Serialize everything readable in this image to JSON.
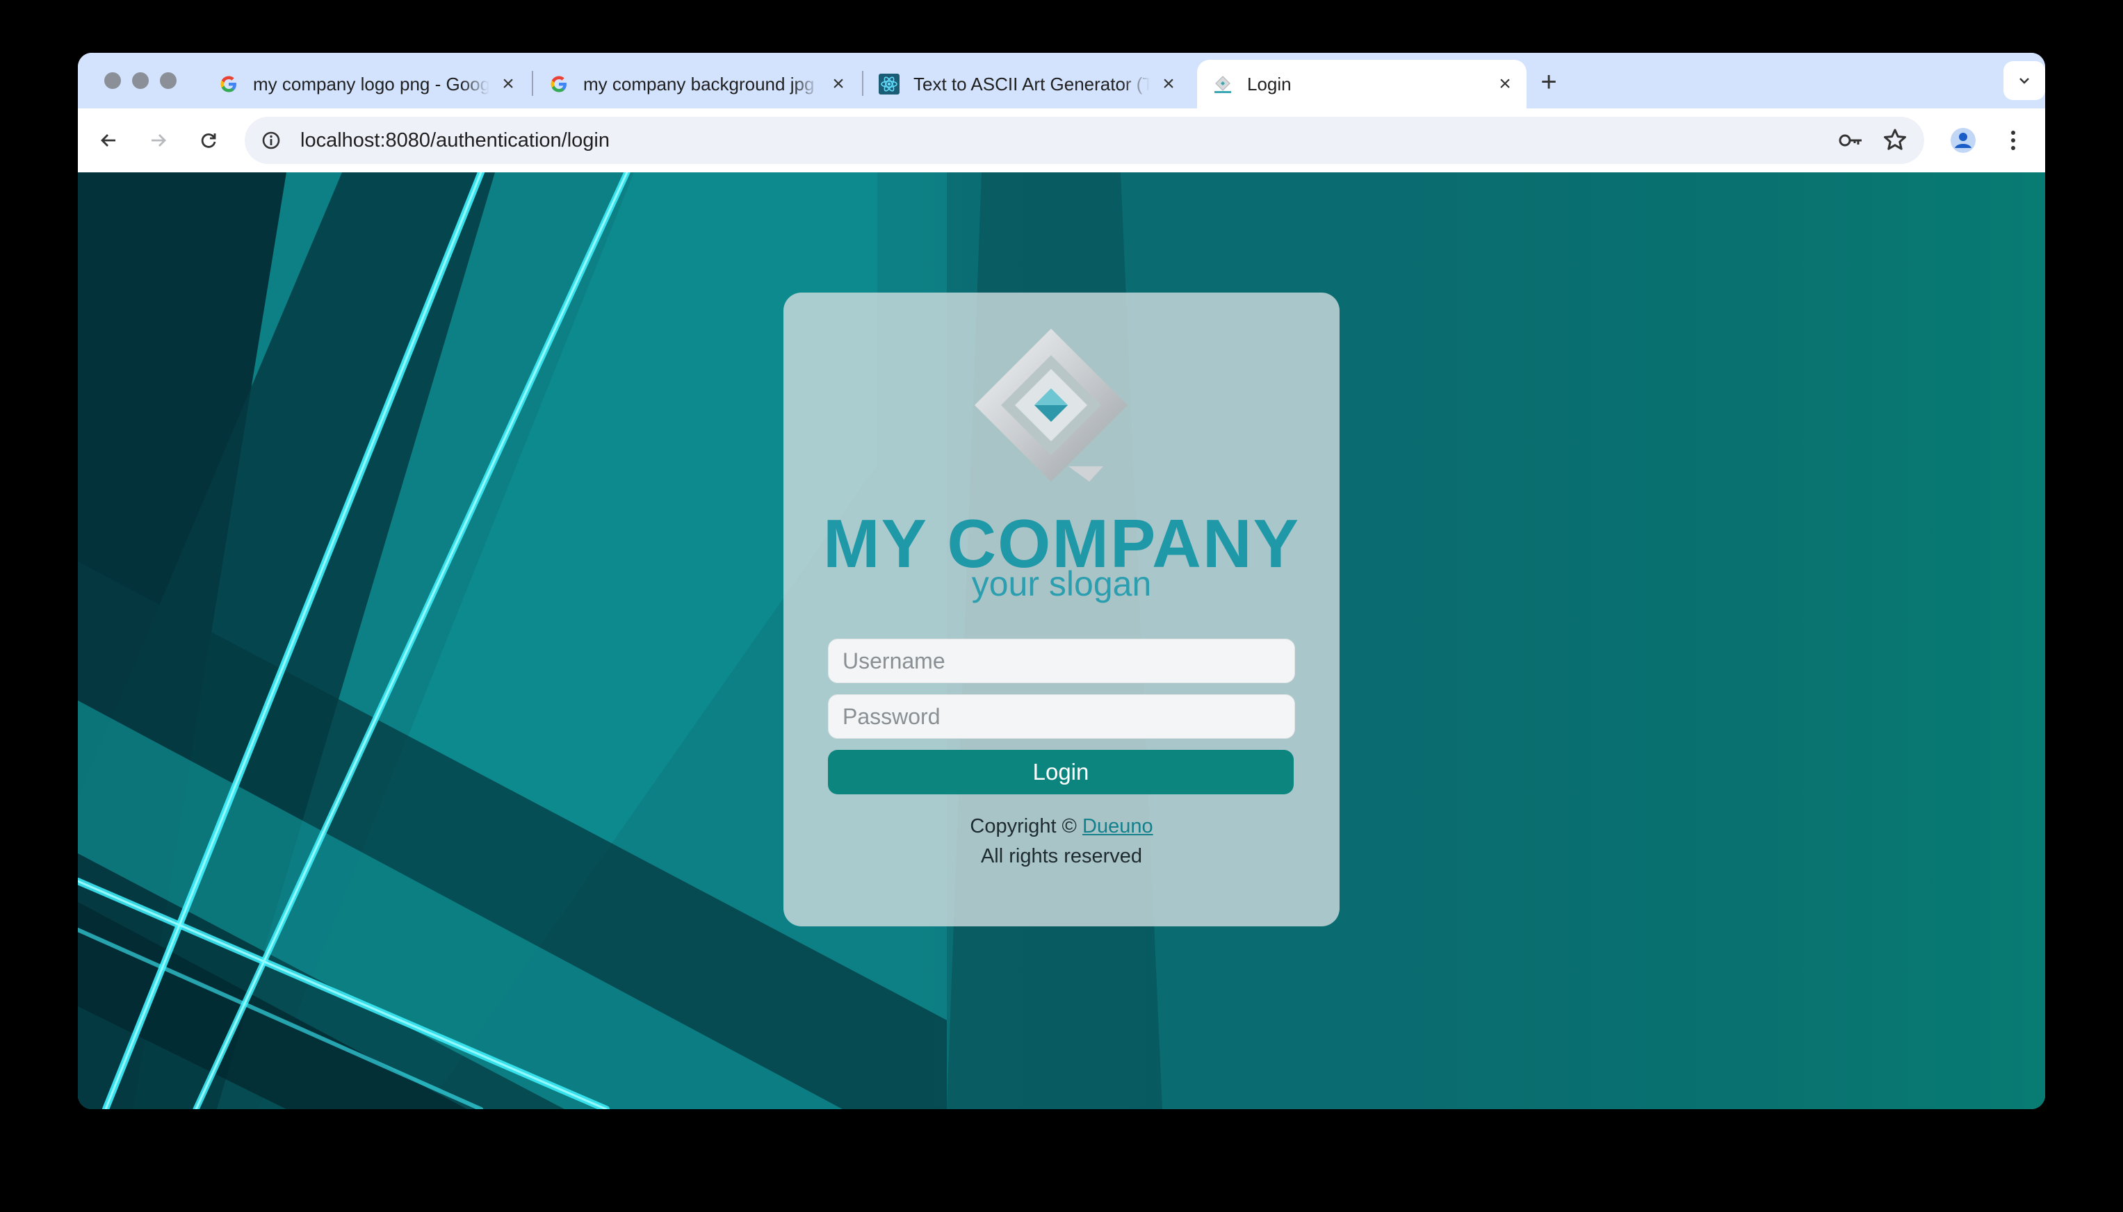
{
  "browser": {
    "tabs": [
      {
        "title": "my company logo png - Google Search",
        "favicon": "google-icon",
        "active": false
      },
      {
        "title": "my company background jpg - Google Search",
        "favicon": "google-icon",
        "active": false
      },
      {
        "title": "Text to ASCII Art Generator (TAAG)",
        "favicon": "react-icon",
        "active": false
      },
      {
        "title": "Login",
        "favicon": "company-logo-icon",
        "active": true
      }
    ],
    "url": "localhost:8080/authentication/login"
  },
  "login": {
    "brand_name": "MY COMPANY",
    "slogan": "your slogan",
    "username_placeholder": "Username",
    "password_placeholder": "Password",
    "login_label": "Login",
    "copyright_prefix": "Copyright ©",
    "copyright_link": "Dueuno",
    "rights": "All rights reserved"
  },
  "colors": {
    "accent": "#0c857f",
    "brand": "#1f98a8",
    "tab_strip": "#d3e3fd"
  }
}
